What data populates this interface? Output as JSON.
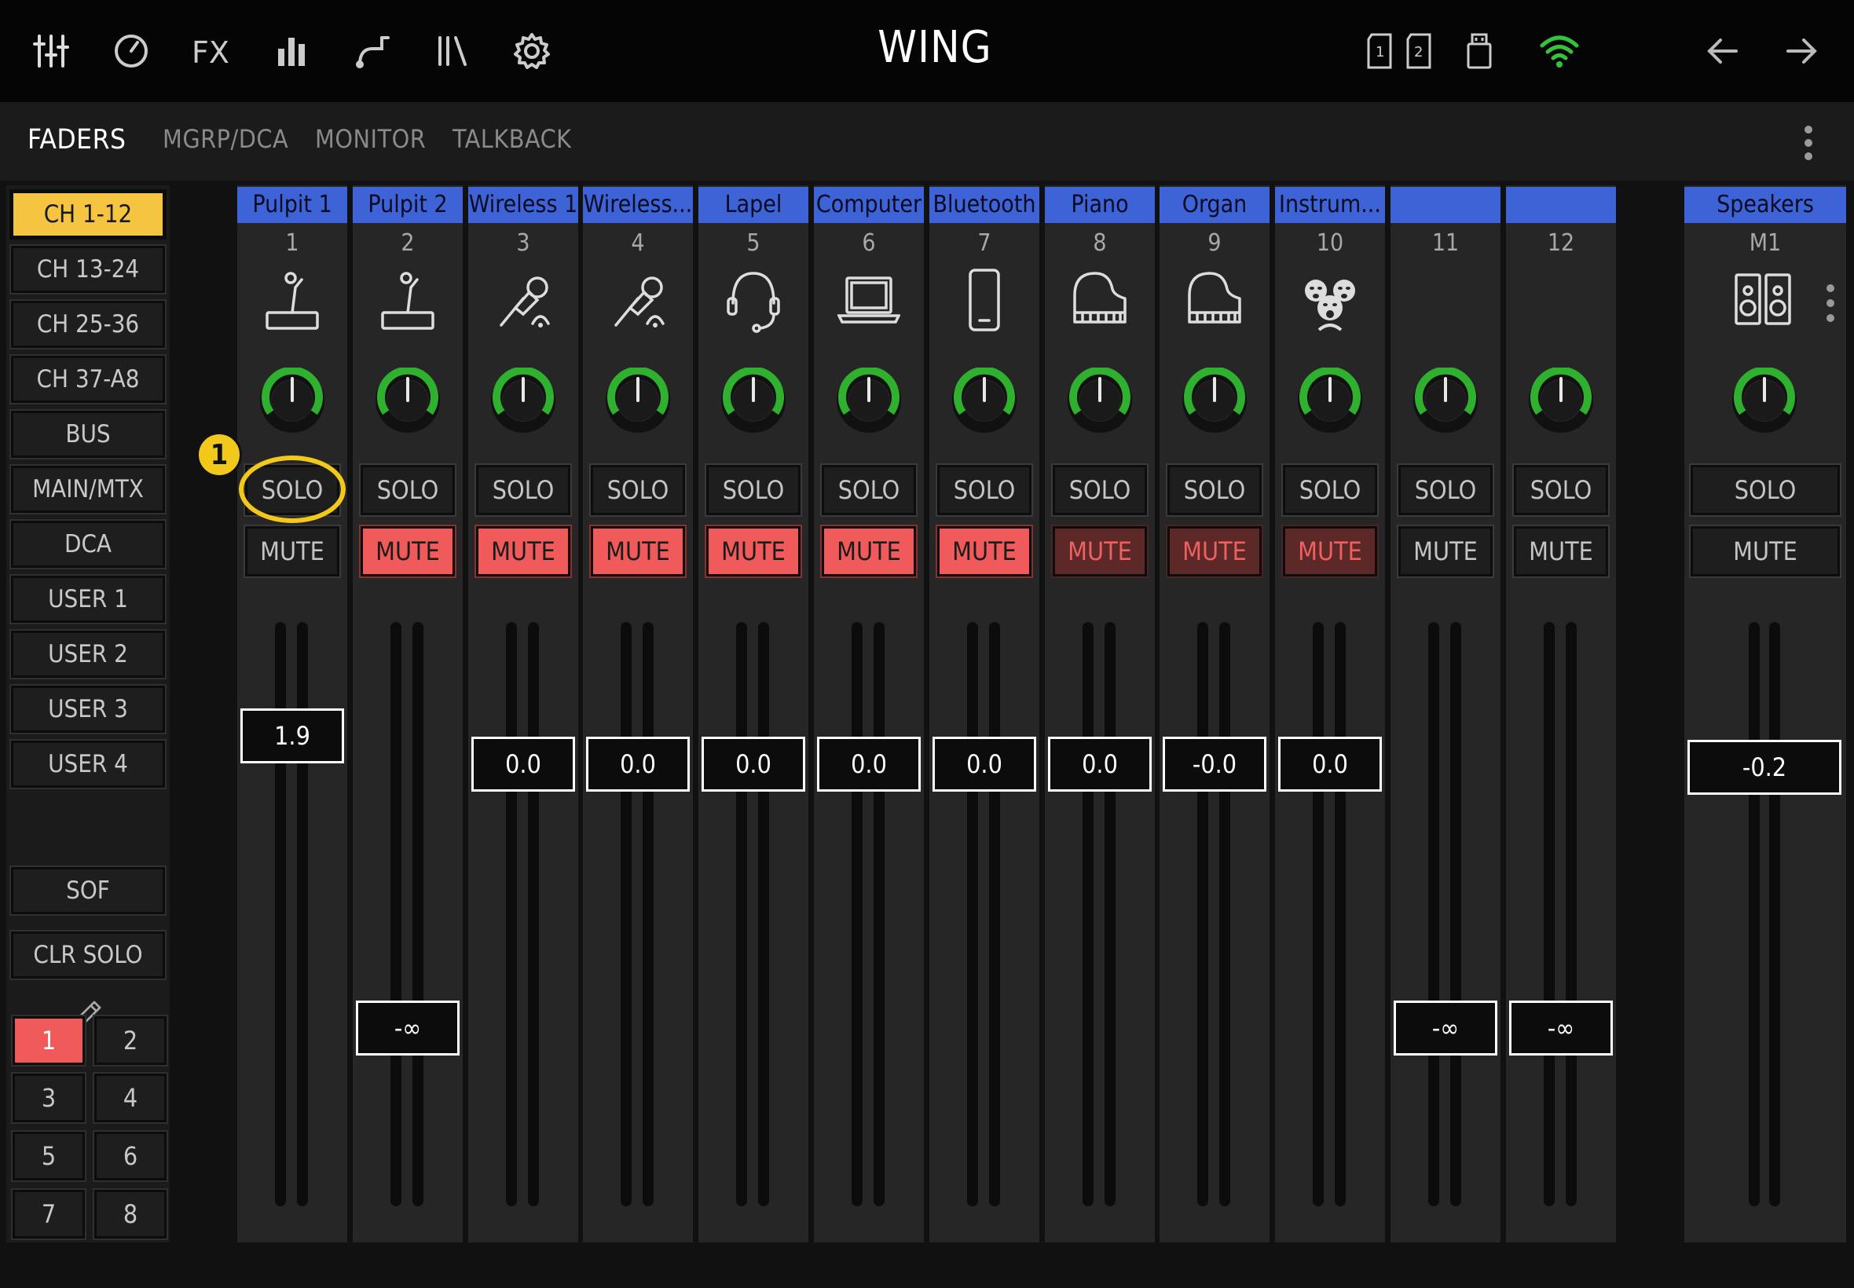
{
  "app": {
    "title": "WING"
  },
  "topbar": {
    "left_icons": [
      "mixer-sliders-icon",
      "clock-meter-icon",
      "fx-icon",
      "bar-meter-icon",
      "routing-icon",
      "library-icon",
      "gear-icon"
    ],
    "right_icons": [
      "card-slot-1-icon",
      "card-slot-2-icon",
      "usb-drive-icon",
      "wifi-icon",
      "back-arrow-icon",
      "forward-arrow-icon"
    ],
    "fx_label": "FX",
    "card1_label": "1",
    "card2_label": "2",
    "wifi_color": "#34c43a"
  },
  "tabs": [
    {
      "label": "FADERS",
      "active": true
    },
    {
      "label": "MGRP/DCA",
      "active": false
    },
    {
      "label": "MONITOR",
      "active": false
    },
    {
      "label": "TALKBACK",
      "active": false
    }
  ],
  "sidebar": {
    "layers": [
      {
        "label": "CH 1-12",
        "selected": true
      },
      {
        "label": "CH 13-24",
        "selected": false
      },
      {
        "label": "CH 25-36",
        "selected": false
      },
      {
        "label": "CH 37-A8",
        "selected": false
      },
      {
        "label": "BUS",
        "selected": false
      },
      {
        "label": "MAIN/MTX",
        "selected": false
      },
      {
        "label": "DCA",
        "selected": false
      },
      {
        "label": "USER 1",
        "selected": false
      },
      {
        "label": "USER 2",
        "selected": false
      },
      {
        "label": "USER 3",
        "selected": false
      },
      {
        "label": "USER 4",
        "selected": false
      }
    ],
    "sof_label": "SOF",
    "clr_solo_label": "CLR SOLO",
    "pages": [
      "1",
      "2",
      "3",
      "4",
      "5",
      "6",
      "7",
      "8"
    ],
    "selected_page": "1"
  },
  "channels": [
    {
      "name": "Pulpit 1",
      "number": "1",
      "icon": "podium-mic-icon",
      "solo_label": "SOLO",
      "mute_label": "MUTE",
      "mute_state": "off",
      "fader_value": "1.9",
      "fader_level_db": 1.9
    },
    {
      "name": "Pulpit 2",
      "number": "2",
      "icon": "podium-mic-icon",
      "solo_label": "SOLO",
      "mute_label": "MUTE",
      "mute_state": "on",
      "fader_value": "-∞",
      "fader_level_db": null
    },
    {
      "name": "Wireless 1",
      "number": "3",
      "icon": "wireless-mic-icon",
      "solo_label": "SOLO",
      "mute_label": "MUTE",
      "mute_state": "on",
      "fader_value": "0.0",
      "fader_level_db": 0.0
    },
    {
      "name": "Wireless...",
      "number": "4",
      "icon": "wireless-mic-icon",
      "solo_label": "SOLO",
      "mute_label": "MUTE",
      "mute_state": "on",
      "fader_value": "0.0",
      "fader_level_db": 0.0
    },
    {
      "name": "Lapel",
      "number": "5",
      "icon": "headset-icon",
      "solo_label": "SOLO",
      "mute_label": "MUTE",
      "mute_state": "on",
      "fader_value": "0.0",
      "fader_level_db": 0.0
    },
    {
      "name": "Computer",
      "number": "6",
      "icon": "laptop-icon",
      "solo_label": "SOLO",
      "mute_label": "MUTE",
      "mute_state": "on",
      "fader_value": "0.0",
      "fader_level_db": 0.0
    },
    {
      "name": "Bluetooth",
      "number": "7",
      "icon": "phone-icon",
      "solo_label": "SOLO",
      "mute_label": "MUTE",
      "mute_state": "on",
      "fader_value": "0.0",
      "fader_level_db": 0.0
    },
    {
      "name": "Piano",
      "number": "8",
      "icon": "piano-icon",
      "solo_label": "SOLO",
      "mute_label": "MUTE",
      "mute_state": "dim",
      "fader_value": "0.0",
      "fader_level_db": 0.0
    },
    {
      "name": "Organ",
      "number": "9",
      "icon": "piano-icon",
      "solo_label": "SOLO",
      "mute_label": "MUTE",
      "mute_state": "dim",
      "fader_value": "-0.0",
      "fader_level_db": 0.0
    },
    {
      "name": "Instrum...",
      "number": "10",
      "icon": "choir-icon",
      "solo_label": "SOLO",
      "mute_label": "MUTE",
      "mute_state": "dim",
      "fader_value": "0.0",
      "fader_level_db": 0.0
    },
    {
      "name": "",
      "number": "11",
      "icon": "",
      "solo_label": "SOLO",
      "mute_label": "MUTE",
      "mute_state": "off",
      "fader_value": "-∞",
      "fader_level_db": null
    },
    {
      "name": "",
      "number": "12",
      "icon": "",
      "solo_label": "SOLO",
      "mute_label": "MUTE",
      "mute_state": "off",
      "fader_value": "-∞",
      "fader_level_db": null
    }
  ],
  "main": {
    "name": "Speakers",
    "number": "M1",
    "icon": "speakers-icon",
    "solo_label": "SOLO",
    "mute_label": "MUTE",
    "mute_state": "off",
    "fader_value": "-0.2",
    "fader_level_db": -0.2
  },
  "annotation": {
    "label": "1"
  },
  "colors": {
    "accent_yellow": "#f5c542",
    "mute_red": "#f05a5a",
    "strip_blue": "#3e63d6",
    "knob_green": "#2fb02f"
  }
}
